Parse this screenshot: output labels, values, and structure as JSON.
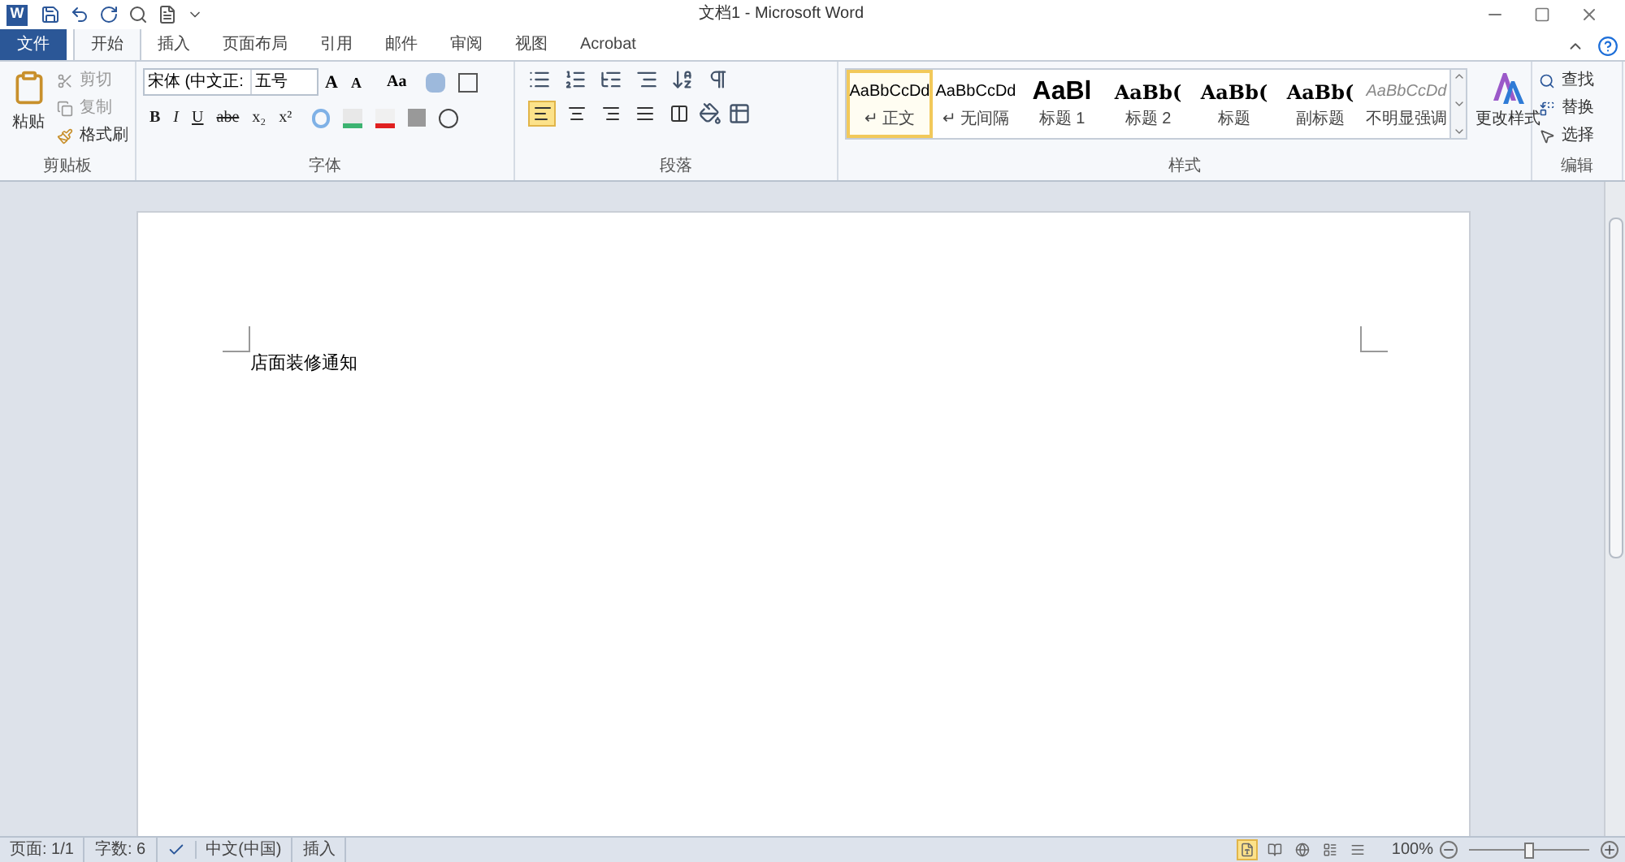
{
  "title_bar": {
    "app_badge": "W",
    "title": "文档1 - Microsoft Word"
  },
  "tabs": [
    {
      "label": "文件",
      "kind": "file",
      "selected": false
    },
    {
      "label": "开始",
      "kind": "tab",
      "selected": true
    },
    {
      "label": "插入",
      "kind": "tab",
      "selected": false
    },
    {
      "label": "页面布局",
      "kind": "tab",
      "selected": false
    },
    {
      "label": "引用",
      "kind": "tab",
      "selected": false
    },
    {
      "label": "邮件",
      "kind": "tab",
      "selected": false
    },
    {
      "label": "审阅",
      "kind": "tab",
      "selected": false
    },
    {
      "label": "视图",
      "kind": "tab",
      "selected": false
    },
    {
      "label": "Acrobat",
      "kind": "tab",
      "selected": false
    }
  ],
  "clipboard": {
    "title": "剪贴板",
    "paste": "粘贴",
    "cut": "剪切",
    "copy": "复制",
    "format_painter": "格式刷"
  },
  "font": {
    "title": "字体",
    "font_name": "宋体 (中文正:",
    "font_size": "五号",
    "grow_font": "A",
    "shrink_font": "A",
    "change_case": "Aa",
    "format_buttons": [
      "B",
      "I",
      "U",
      "abe",
      "x₂",
      "x²"
    ]
  },
  "paragraph": {
    "title": "段落",
    "align": [
      {
        "selected": true
      },
      {
        "selected": false
      },
      {
        "selected": false
      },
      {
        "selected": false
      },
      {
        "selected": false
      }
    ]
  },
  "styles": {
    "title": "样式",
    "items": [
      {
        "preview": "AaBbCcDd",
        "name": "↵ 正文",
        "kind": "normal",
        "selected": true
      },
      {
        "preview": "AaBbCcDd",
        "name": "↵ 无间隔",
        "kind": "normal",
        "selected": false
      },
      {
        "preview": "AaBl",
        "name": "标题 1",
        "kind": "heading1",
        "selected": false
      },
      {
        "preview": "AaBb(",
        "name": "标题 2",
        "kind": "heading",
        "selected": false
      },
      {
        "preview": "AaBb(",
        "name": "标题",
        "kind": "heading",
        "selected": false
      },
      {
        "preview": "AaBb(",
        "name": "副标题",
        "kind": "heading",
        "selected": false
      },
      {
        "preview": "AaBbCcDd",
        "name": "不明显强调",
        "kind": "subtle",
        "selected": false
      }
    ],
    "change_styles": "更改样式"
  },
  "editing": {
    "title": "编辑",
    "find": "查找",
    "replace": "替换",
    "select": "选择"
  },
  "document": {
    "paragraphs": [
      "店面装修通知"
    ]
  },
  "status_bar": {
    "items": [
      "页面: 1/1",
      "字数: 6",
      "中文(中国)",
      "插入"
    ],
    "views": [
      {
        "selected": true
      },
      {
        "selected": false
      },
      {
        "selected": false
      },
      {
        "selected": false
      },
      {
        "selected": false
      }
    ],
    "zoom": "100%",
    "zoom_slider": {
      "level": 0.5
    }
  }
}
